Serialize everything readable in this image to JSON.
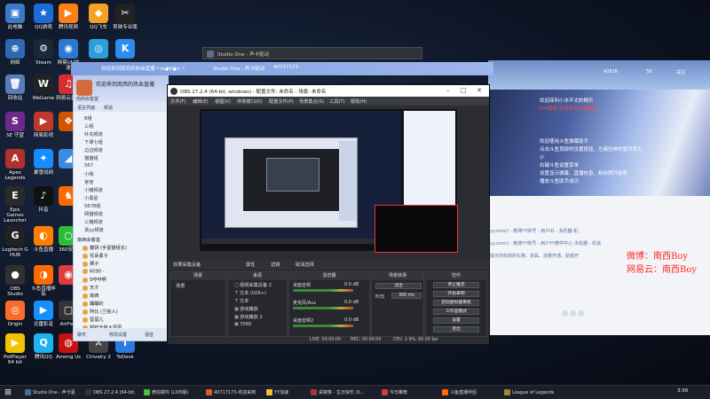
{
  "desktop_icons": [
    {
      "label": "此电脑",
      "glyph": "▣",
      "color": "#3a78c9"
    },
    {
      "label": "QQ游戏",
      "glyph": "★",
      "color": "#1d6ad8"
    },
    {
      "label": "腾讯视频",
      "glyph": "▶",
      "color": "#ff7f17"
    },
    {
      "label": "QQ飞车",
      "glyph": "◆",
      "color": "#f3a221"
    },
    {
      "label": "剪映专业版",
      "glyph": "✂",
      "color": "#222"
    },
    {
      "label": "网络",
      "glyph": "⊕",
      "color": "#2e69b4"
    },
    {
      "label": "Steam",
      "glyph": "⚙",
      "color": "#1b2838"
    },
    {
      "label": "网易UU加速",
      "glyph": "◉",
      "color": "#2a7ad1"
    },
    {
      "label": "",
      "glyph": "◎",
      "color": "#2c9ed8"
    },
    {
      "label": "",
      "glyph": "K",
      "color": "#2c8cf0"
    },
    {
      "label": "回收站",
      "glyph": "🗑",
      "color": "#5a7db5"
    },
    {
      "label": "WeGame",
      "glyph": "W",
      "color": "#222"
    },
    {
      "label": "网易云音乐",
      "glyph": "♫",
      "color": "#d62d2d"
    },
    {
      "label": "SE 守望",
      "glyph": "S",
      "color": "#6d2a8a"
    },
    {
      "label": "网易影视",
      "glyph": "▶",
      "color": "#c0392b"
    },
    {
      "label": "",
      "glyph": "❖",
      "color": "#d35400"
    },
    {
      "label": "Apex Legends",
      "glyph": "A",
      "color": "#b03030"
    },
    {
      "label": "暴雪战网",
      "glyph": "✦",
      "color": "#148eff"
    },
    {
      "label": "",
      "glyph": "◢",
      "color": "#3c8be0"
    },
    {
      "label": "Epic Games Launcher",
      "glyph": "E",
      "color": "#2a2a2a"
    },
    {
      "label": "抖音",
      "glyph": "♪",
      "color": "#111"
    },
    {
      "label": "",
      "glyph": "♞",
      "color": "#ff6a00"
    },
    {
      "label": "Logitech G HUB",
      "glyph": "G",
      "color": "#222"
    },
    {
      "label": "斗鱼直播",
      "glyph": "◐",
      "color": "#ff7d00"
    },
    {
      "label": "360安全",
      "glyph": "○",
      "color": "#2bbd3a"
    },
    {
      "label": "OBS Studio",
      "glyph": "●",
      "color": "#303030"
    },
    {
      "label": "斗鱼直播伴侣",
      "glyph": "◑",
      "color": "#ff6a00"
    },
    {
      "label": "",
      "glyph": "◉",
      "color": "#e23b3b"
    },
    {
      "label": "Origin",
      "glyph": "◎",
      "color": "#f56c2d"
    },
    {
      "label": "迅雷影音",
      "glyph": "▶",
      "color": "#1690ff"
    },
    {
      "label": "AirPlay",
      "glyph": "▢",
      "color": "#333"
    },
    {
      "label": "PotPlayer 64 bit",
      "glyph": "▶",
      "color": "#f2c200"
    },
    {
      "label": "腾讯QQ",
      "glyph": "Q",
      "color": "#1db3f0"
    },
    {
      "label": "Among Us",
      "glyph": "◍",
      "color": "#c51111"
    },
    {
      "label": "Chivalry 2",
      "glyph": "⚔",
      "color": "#444"
    },
    {
      "label": "ToDesk",
      "glyph": "T",
      "color": "#2a7ae2"
    }
  ],
  "studio_window": {
    "title": "Studio One - 声卡驱动"
  },
  "live_window_tabs": [
    "欢迎来到南西的热血直播ヾ(o◕∀◕)ﾉヾ",
    "Studio One - 声卡驱动",
    "40717173"
  ],
  "yy_panel": {
    "room_label": "欢迎来到南西的热血直播",
    "tabs": [
      "语言界面",
      "频道"
    ],
    "channel_header": "南西会客室",
    "channels": [
      "B组",
      "三组",
      "补充频道",
      "下课七组",
      "边边频道",
      "猫猫组",
      "567",
      "小我",
      "官官",
      "小猪频道",
      "小黑星",
      "5678组",
      "网猫频道",
      "三猪频道",
      "贡yy频道"
    ],
    "second_section": "南西会客室",
    "users": [
      "糖饼 (手雷猫组长)",
      "花朵勇子",
      "狮子",
      "6090 ·",
      "5哼哼啊",
      "天才",
      "南西",
      "蹦蹦的",
      "阿比 (兰帕人)",
      "蛋蛋儿",
      "超吃无敌大蛋蛋"
    ],
    "foot": [
      "聊天",
      "修改设置",
      "语音"
    ]
  },
  "obs": {
    "title": "OBS 27.2.4 (64-bit, windows) - 配置文件: 未命名 - 场景: 未命名",
    "menu": [
      "文件(F)",
      "编辑(E)",
      "视图(V)",
      "停靠窗口(D)",
      "配置文件(P)",
      "场景集合(S)",
      "工具(T)",
      "帮助(H)"
    ],
    "scene_bar": [
      "效果采集设备",
      "属性",
      "滤镜",
      "取消选择"
    ],
    "docks": {
      "scenes": "场景",
      "sources": "来源",
      "mixer": "混音器",
      "transitions": "场景转场",
      "controls": "控件"
    },
    "scenes_list": [
      "场景"
    ],
    "sources_list": [
      "视频采集设备 2",
      "文本 (GDI+)",
      "文本",
      "游戏捕获",
      "游戏捕获 2",
      "7080"
    ],
    "mixer_channels": [
      {
        "name": "桌面音频",
        "db": "0.0 dB"
      },
      {
        "name": "麦克风/Aux",
        "db": "0.0 dB"
      },
      {
        "name": "桌面音频2",
        "db": "0.0 dB"
      }
    ],
    "transition": {
      "type": "淡出",
      "duration_label": "时长",
      "duration": "300 ms"
    },
    "controls": [
      "停止推流",
      "开始录制",
      "启动虚拟摄像机",
      "工作室模式",
      "设置",
      "退出"
    ],
    "status": [
      "LIVE: 00:00:00",
      "REC: 00:00:00",
      "CPU: 2.9%, 60.00 fps"
    ]
  },
  "live_page": {
    "dims": [
      "40828",
      "58",
      "关注"
    ],
    "chat_lines": [
      {
        "text": "欢迎菲利小冰不太妙精乐",
        "red": false
      },
      {
        "text": "5m南西 欢迎来到本直播间",
        "red": true
      },
      {
        "text": "欢迎使用斗鱼弹幕助手",
        "red": false
      },
      {
        "text": "点击斗鱼顶部的设置按钮，左键拉伸的窗改变大小",
        "red": false
      },
      {
        "text": "右键斗鱼设置菜单",
        "red": false
      },
      {
        "text": "设置显示弹幕、直播信息、粉丝牌升级等",
        "red": false
      },
      {
        "text": "播放斗鱼助手成功",
        "red": false
      }
    ],
    "urls": [
      "yy.com/) - 微课YY账号 - 用户ID - 多机器-机",
      "yy.com/) - 微课YY账号 - 用户YY教学中心-多机器 - 机该",
      "提示你收到的礼物、道具、流量开通、贴纸开"
    ],
    "overlay": {
      "line1": "微博：南西Boy",
      "line2": "网易云：南西Boy"
    }
  },
  "taskbar": {
    "items": [
      {
        "label": "Studio One - 声卡驱",
        "color": "#4a6a90"
      },
      {
        "label": "OBS 27.2.4 (64-bit,",
        "color": "#333"
      },
      {
        "label": "微信邮件 (LIVE版)",
        "color": "#4bbd3a"
      },
      {
        "label": "40717173-欢迎来到",
        "color": "#e15a2b"
      },
      {
        "label": "YY加速",
        "color": "#f0c030"
      },
      {
        "label": "桌镜像 - 生日快乐 (0...",
        "color": "#a33"
      },
      {
        "label": "今日推荐",
        "color": "#d23b3b"
      },
      {
        "label": "斗鱼直播伴侣",
        "color": "#ff6a00"
      },
      {
        "label": "League of Legends",
        "color": "#a0862a"
      }
    ],
    "clock": "3:56"
  }
}
